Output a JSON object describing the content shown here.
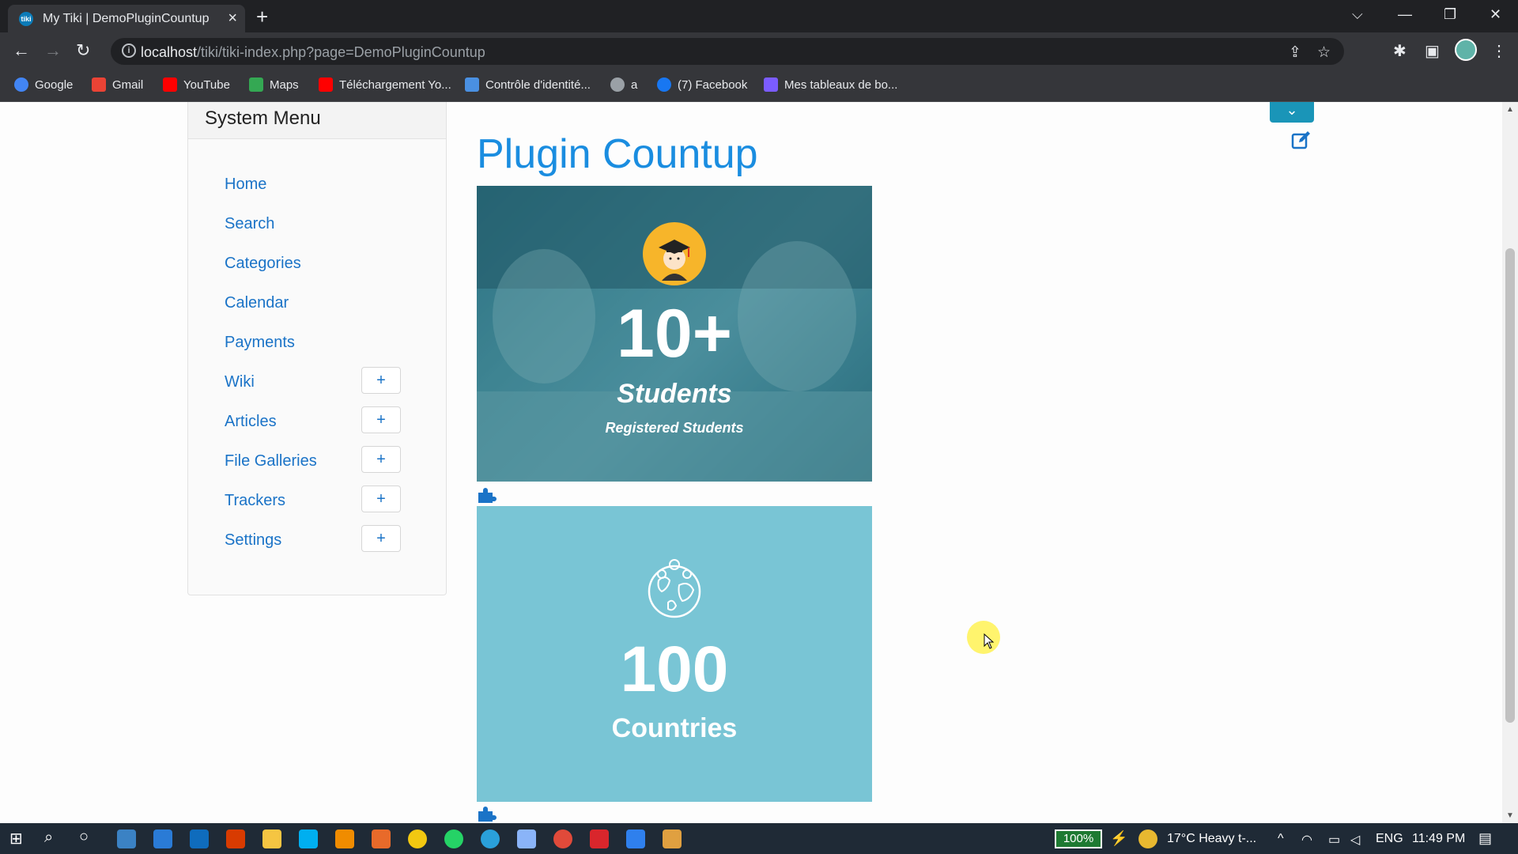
{
  "browser": {
    "tab_title": "My Tiki | DemoPluginCountup",
    "url_host": "localhost",
    "url_path": "/tiki/tiki-index.php?page=DemoPluginCountup",
    "bookmarks": [
      {
        "label": "Google",
        "color": "#4285f4"
      },
      {
        "label": "Gmail",
        "color": "#ea4335"
      },
      {
        "label": "YouTube",
        "color": "#ff0000"
      },
      {
        "label": "Maps",
        "color": "#34a853"
      },
      {
        "label": "Téléchargement Yo...",
        "color": "#ff0000"
      },
      {
        "label": "Contrôle d'identité...",
        "color": "#4a90e2"
      },
      {
        "label": "a",
        "color": "#9aa0a6"
      },
      {
        "label": "(7) Facebook",
        "color": "#1877f2"
      },
      {
        "label": "Mes tableaux de bo...",
        "color": "#7b5cff"
      }
    ]
  },
  "sidebar": {
    "title": "System Menu",
    "items": [
      {
        "label": "Home",
        "expandable": false
      },
      {
        "label": "Search",
        "expandable": false
      },
      {
        "label": "Categories",
        "expandable": false
      },
      {
        "label": "Calendar",
        "expandable": false
      },
      {
        "label": "Payments",
        "expandable": false
      },
      {
        "label": "Wiki",
        "expandable": true
      },
      {
        "label": "Articles",
        "expandable": true
      },
      {
        "label": "File Galleries",
        "expandable": true
      },
      {
        "label": "Trackers",
        "expandable": true
      },
      {
        "label": "Settings",
        "expandable": true
      }
    ],
    "expand_symbol": "+"
  },
  "main": {
    "title": "Plugin Countup",
    "dropdown_symbol": "⌄",
    "countups": [
      {
        "number": "10+",
        "label": "Students",
        "sublabel": "Registered Students",
        "icon": "graduate-icon"
      },
      {
        "number": "100",
        "label": "Countries",
        "icon": "globe-icon"
      }
    ]
  },
  "taskbar": {
    "battery": "100%",
    "weather": "17°C  Heavy t-...",
    "language": "ENG",
    "time": "11:49 PM"
  },
  "colors": {
    "link": "#1a73c7",
    "title": "#1a8de0",
    "card2_bg": "#79c5d5",
    "accent": "#1a95b8"
  }
}
